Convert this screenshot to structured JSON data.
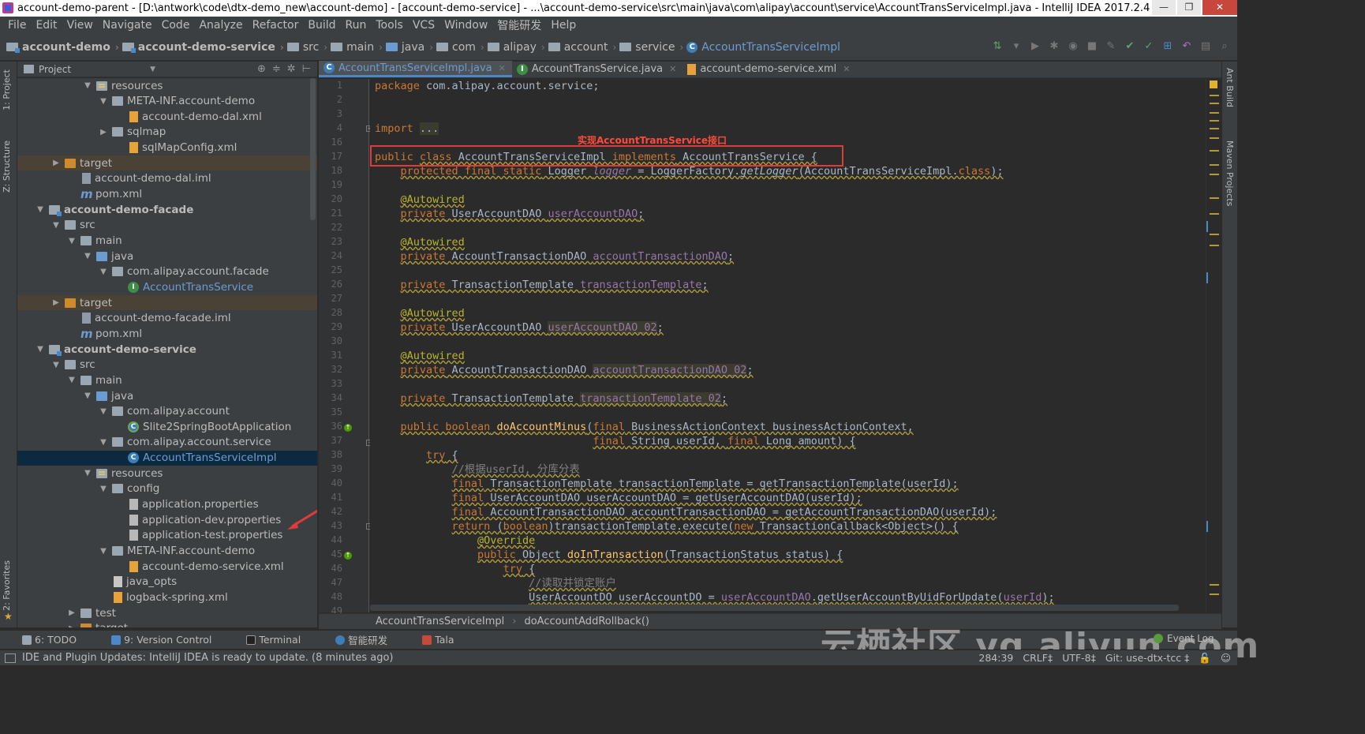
{
  "window": {
    "title": "account-demo-parent - [D:\\antwork\\code\\dtx-demo_new\\account-demo] - [account-demo-service] - ...\\account-demo-service\\src\\main\\java\\com\\alipay\\account\\service\\AccountTransServiceImpl.java - IntelliJ IDEA 2017.2.4",
    "buttons": [
      "—",
      "❐",
      "✕"
    ]
  },
  "menu": [
    "File",
    "Edit",
    "View",
    "Navigate",
    "Code",
    "Analyze",
    "Refactor",
    "Build",
    "Run",
    "Tools",
    "VCS",
    "Window",
    "智能研发",
    "Help"
  ],
  "breadcrumbs": [
    "account-demo",
    "account-demo-service",
    "src",
    "main",
    "java",
    "com",
    "alipay",
    "account",
    "service",
    "AccountTransServiceImpl"
  ],
  "project_panel": {
    "title": "Project",
    "rows": [
      {
        "indent": 4,
        "arrow": "▼",
        "icon": "folder-res",
        "label": "resources"
      },
      {
        "indent": 5,
        "arrow": "▼",
        "icon": "folder",
        "label": "META-INF.account-demo"
      },
      {
        "indent": 6,
        "arrow": "",
        "icon": "xml",
        "label": "account-demo-dal.xml"
      },
      {
        "indent": 5,
        "arrow": "▶",
        "icon": "folder",
        "label": "sqlmap"
      },
      {
        "indent": 6,
        "arrow": "",
        "icon": "xml",
        "label": "sqlMapConfig.xml"
      },
      {
        "indent": 2,
        "arrow": "▶",
        "icon": "folder-orange",
        "label": "target",
        "tgt": true
      },
      {
        "indent": 3,
        "arrow": "",
        "icon": "iml",
        "label": "account-demo-dal.iml"
      },
      {
        "indent": 3,
        "arrow": "",
        "icon": "mvn",
        "label": "pom.xml"
      },
      {
        "indent": 1,
        "arrow": "▼",
        "icon": "folder-mod",
        "label": "account-demo-facade",
        "bold": true
      },
      {
        "indent": 2,
        "arrow": "▼",
        "icon": "folder",
        "label": "src"
      },
      {
        "indent": 3,
        "arrow": "▼",
        "icon": "folder",
        "label": "main"
      },
      {
        "indent": 4,
        "arrow": "▼",
        "icon": "folder-blue",
        "label": "java"
      },
      {
        "indent": 5,
        "arrow": "▼",
        "icon": "folder",
        "label": "com.alipay.account.facade"
      },
      {
        "indent": 6,
        "arrow": "",
        "icon": "interface",
        "label": "AccountTransService",
        "blue": true
      },
      {
        "indent": 2,
        "arrow": "▶",
        "icon": "folder-orange",
        "label": "target",
        "tgt": true
      },
      {
        "indent": 3,
        "arrow": "",
        "icon": "iml",
        "label": "account-demo-facade.iml"
      },
      {
        "indent": 3,
        "arrow": "",
        "icon": "mvn",
        "label": "pom.xml"
      },
      {
        "indent": 1,
        "arrow": "▼",
        "icon": "folder-mod",
        "label": "account-demo-service",
        "bold": true
      },
      {
        "indent": 2,
        "arrow": "▼",
        "icon": "folder",
        "label": "src"
      },
      {
        "indent": 3,
        "arrow": "▼",
        "icon": "folder",
        "label": "main"
      },
      {
        "indent": 4,
        "arrow": "▼",
        "icon": "folder-blue",
        "label": "java"
      },
      {
        "indent": 5,
        "arrow": "▼",
        "icon": "folder",
        "label": "com.alipay.account"
      },
      {
        "indent": 6,
        "arrow": "",
        "icon": "spring",
        "label": "Slite2SpringBootApplication"
      },
      {
        "indent": 5,
        "arrow": "▼",
        "icon": "folder",
        "label": "com.alipay.account.service"
      },
      {
        "indent": 6,
        "arrow": "",
        "icon": "class",
        "label": "AccountTransServiceImpl",
        "blue": true,
        "selected": true
      },
      {
        "indent": 4,
        "arrow": "▼",
        "icon": "folder-res",
        "label": "resources"
      },
      {
        "indent": 5,
        "arrow": "▼",
        "icon": "folder",
        "label": "config"
      },
      {
        "indent": 6,
        "arrow": "",
        "icon": "prop",
        "label": "application.properties"
      },
      {
        "indent": 6,
        "arrow": "",
        "icon": "prop",
        "label": "application-dev.properties"
      },
      {
        "indent": 6,
        "arrow": "",
        "icon": "prop",
        "label": "application-test.properties"
      },
      {
        "indent": 5,
        "arrow": "▼",
        "icon": "folder",
        "label": "META-INF.account-demo"
      },
      {
        "indent": 6,
        "arrow": "",
        "icon": "xml",
        "label": "account-demo-service.xml"
      },
      {
        "indent": 5,
        "arrow": "",
        "icon": "file",
        "label": "java_opts"
      },
      {
        "indent": 5,
        "arrow": "",
        "icon": "xml",
        "label": "logback-spring.xml"
      },
      {
        "indent": 3,
        "arrow": "▶",
        "icon": "folder",
        "label": "test"
      },
      {
        "indent": 3,
        "arrow": "▶",
        "icon": "folder-orange",
        "label": "target"
      }
    ]
  },
  "left_tool_tabs": [
    "1: Project",
    "Z: Structure",
    "2: Favorites"
  ],
  "right_tool_tabs": [
    "Ant Build",
    "Maven Projects"
  ],
  "editor_tabs": [
    {
      "label": "AccountTransServiceImpl.java",
      "icon": "class",
      "active": true
    },
    {
      "label": "AccountTransService.java",
      "icon": "interface",
      "active": false
    },
    {
      "label": "account-demo-service.xml",
      "icon": "xml",
      "active": false
    }
  ],
  "annotation": {
    "text": "实现AccountTransService接口"
  },
  "code_lines": [
    {
      "n": "1",
      "html": "<span class='kw'>package</span> com.alipay.account.service;"
    },
    {
      "n": "2",
      "html": ""
    },
    {
      "n": "3",
      "html": ""
    },
    {
      "n": "4",
      "html": "<span class='kw'>import</span> <span class='hl'>...</span>"
    },
    {
      "n": "16",
      "html": ""
    },
    {
      "n": "17",
      "html": "<span class='kw'>public</span> <span class='wav'><span class='kw'>class</span> AccountTransServiceImpl <span class='kw'>implements</span> AccountTransService {</span>"
    },
    {
      "n": "18",
      "html": "    <span class='wav'><span class='kw'>protected final static</span> Logger <span class='fi2'>logger</span> = LoggerFactory.<i>getLogger</i>(AccountTransServiceImpl.<span class='kw'>class</span>);</span>"
    },
    {
      "n": "19",
      "html": ""
    },
    {
      "n": "20",
      "html": "    <span class='wav an'>@Autowired</span>"
    },
    {
      "n": "21",
      "html": "    <span class='wav'><span class='kw'>private</span> UserAccountDAO <span class='fld'>userAccountDAO</span>;</span>"
    },
    {
      "n": "22",
      "html": ""
    },
    {
      "n": "23",
      "html": "    <span class='wav an'>@Autowired</span>"
    },
    {
      "n": "24",
      "html": "    <span class='wav'><span class='kw'>private</span> AccountTransactionDAO <span class='fld'>accountTransactionDAO</span>;</span>"
    },
    {
      "n": "25",
      "html": ""
    },
    {
      "n": "26",
      "html": "    <span class='wav'><span class='kw'>private</span> TransactionTemplate <span class='fld'>transactionTemplate</span>;</span>"
    },
    {
      "n": "27",
      "html": ""
    },
    {
      "n": "28",
      "html": "    <span class='wav an'>@Autowired</span>"
    },
    {
      "n": "29",
      "html": "    <span class='wav'><span class='kw'>private</span> UserAccountDAO <span class='fld hl'>userAccountDAO_02</span>;</span>"
    },
    {
      "n": "30",
      "html": ""
    },
    {
      "n": "31",
      "html": "    <span class='wav an'>@Autowired</span>"
    },
    {
      "n": "32",
      "html": "    <span class='wav'><span class='kw'>private</span> AccountTransactionDAO <span class='fld hl'>accountTransactionDAO_02</span>;</span>"
    },
    {
      "n": "33",
      "html": ""
    },
    {
      "n": "34",
      "html": "    <span class='wav'><span class='kw'>private</span> TransactionTemplate <span class='fld hl'>transactionTemplate_02</span>;</span>"
    },
    {
      "n": "35",
      "html": ""
    },
    {
      "n": "36",
      "html": "    <span class='wav'><span class='kw'>public boolean</span> <span class='fn'>doAccountMinus</span>(<span class='kw'>final</span> BusinessActionContext businessActionContext,</span>"
    },
    {
      "n": "37",
      "html": "                                  <span class='wav'><span class='kw'>final</span> String userId, <span class='kw'>final</span> Long amount) {</span>"
    },
    {
      "n": "38",
      "html": "        <span class='wav'><span class='kw'>try</span> {</span>"
    },
    {
      "n": "39",
      "html": "            <span class='wav cm'>//根据userId, 分库分表</span>"
    },
    {
      "n": "40",
      "html": "            <span class='wav'><span class='kw'>final</span> TransactionTemplate transactionTemplate = getTransactionTemplate(userId);</span>"
    },
    {
      "n": "41",
      "html": "            <span class='wav'><span class='kw'>final</span> UserAccountDAO userAccountDAO = getUserAccountDAO(userId);</span>"
    },
    {
      "n": "42",
      "html": "            <span class='wav'><span class='kw'>final</span> AccountTransactionDAO accountTransactionDAO = getAccountTransactionDAO(userId);</span>"
    },
    {
      "n": "43",
      "html": "            <span class='wav'><span class='kw'>return</span> (<span class='kw'>boolean</span>)transactionTemplate.execute(<span class='kw'>new</span> TransactionCallback&lt;Object&gt;() {</span>"
    },
    {
      "n": "44",
      "html": "                <span class='wav an'>@Override</span>"
    },
    {
      "n": "45",
      "html": "                <span class='wav'><span class='kw'>public</span> Object <span class='fn'>doInTransaction</span>(TransactionStatus status) {</span>"
    },
    {
      "n": "46",
      "html": "                    <span class='wav'><span class='kw'>try</span> {</span>"
    },
    {
      "n": "47",
      "html": "                        <span class='wav cm'>//读取并锁定账户</span>"
    },
    {
      "n": "48",
      "html": "                        <span class='wav'>UserAccountDO userAccountDO = <span class='fld'>userAccountDAO</span>.getUserAccountByUidForUpdate(<span class='fld'>userId</span>);</span>"
    },
    {
      "n": "49",
      "html": ""
    }
  ],
  "code_breadcrumb": [
    "AccountTransServiceImpl",
    "doAccountAddRollback()"
  ],
  "bottom_tools": [
    "6: TODO",
    "9: Version Control",
    "Terminal",
    "智能研发",
    "Tala"
  ],
  "event_log": "Event Log",
  "watermark": "云栖社区 yq.aliyun.com",
  "status": {
    "message": "IDE and Plugin Updates: IntelliJ IDEA is ready to update. (8 minutes ago)",
    "position": "284:39",
    "line_sep": "CRLF‡",
    "encoding": "UTF-8‡",
    "git": "Git: use-dtx-tcc ‡"
  }
}
